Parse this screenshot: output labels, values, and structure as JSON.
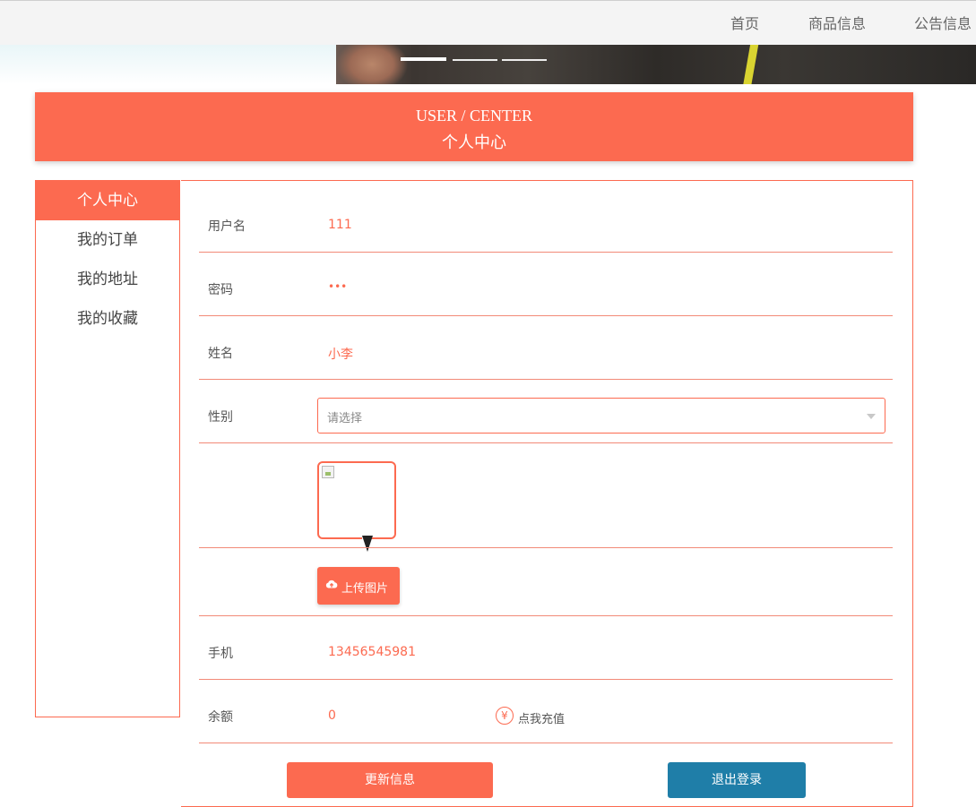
{
  "nav": {
    "items": [
      "首页",
      "商品信息",
      "公告信息"
    ]
  },
  "banner": {
    "slides": 3,
    "active_slide": 1
  },
  "header": {
    "title_en": "USER / CENTER",
    "title_cn": "个人中心"
  },
  "sidebar": {
    "items": [
      {
        "label": "个人中心",
        "active": true
      },
      {
        "label": "我的订单",
        "active": false
      },
      {
        "label": "我的地址",
        "active": false
      },
      {
        "label": "我的收藏",
        "active": false
      }
    ]
  },
  "form": {
    "username": {
      "label": "用户名",
      "value": "111"
    },
    "password": {
      "label": "密码",
      "value": "•••"
    },
    "name": {
      "label": "姓名",
      "value": "小李"
    },
    "gender": {
      "label": "性别",
      "placeholder": "请选择"
    },
    "upload_label": "上传图片",
    "phone": {
      "label": "手机",
      "value": "13456545981"
    },
    "balance": {
      "label": "余额",
      "value": "0"
    },
    "recharge_icon": "¥",
    "recharge_label": "点我充值"
  },
  "buttons": {
    "update": "更新信息",
    "logout": "退出登录"
  },
  "colors": {
    "accent": "#fc6a50",
    "logout": "#1f7ea8"
  }
}
